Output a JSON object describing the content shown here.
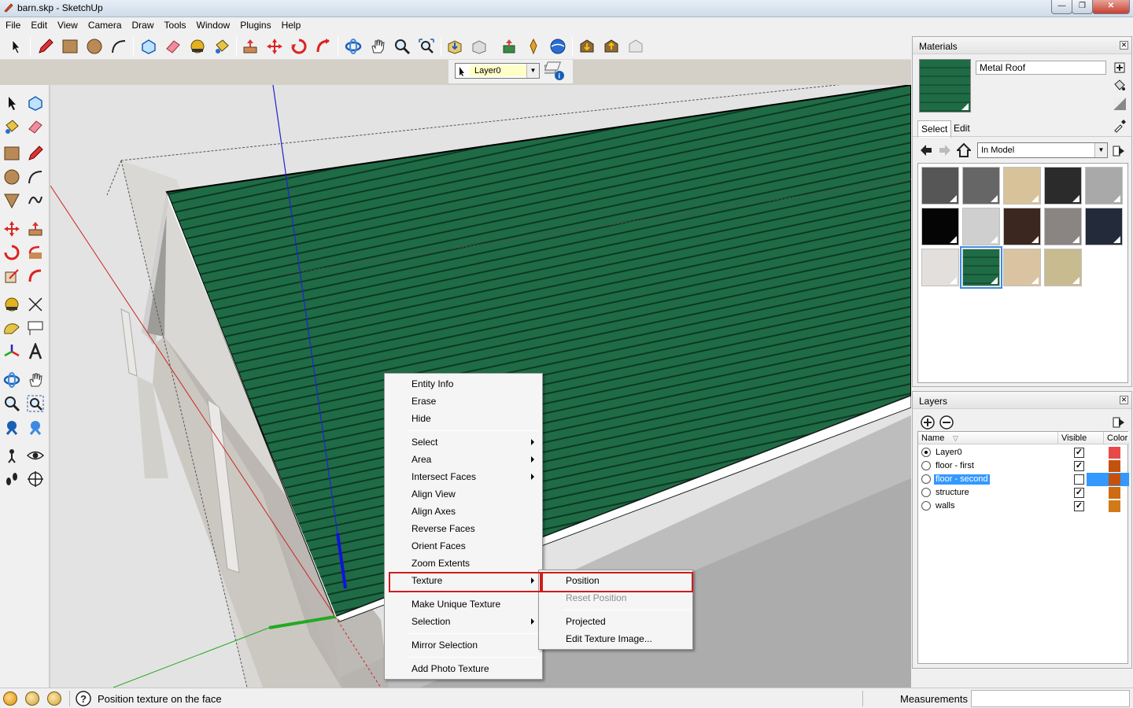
{
  "window": {
    "title": "barn.skp - SketchUp",
    "controls": {
      "minimize": "—",
      "maximize": "❐",
      "close": "✕"
    }
  },
  "menubar": [
    "File",
    "Edit",
    "View",
    "Camera",
    "Draw",
    "Tools",
    "Window",
    "Plugins",
    "Help"
  ],
  "layer_toolbar": {
    "current_layer": "Layer0"
  },
  "context_menu": {
    "items": [
      {
        "label": "Entity Info",
        "submenu": false
      },
      {
        "label": "Erase",
        "submenu": false
      },
      {
        "label": "Hide",
        "submenu": false
      },
      {
        "label": "Select",
        "submenu": true
      },
      {
        "label": "Area",
        "submenu": true
      },
      {
        "label": "Intersect Faces",
        "submenu": true
      },
      {
        "label": "Align View",
        "submenu": false
      },
      {
        "label": "Align Axes",
        "submenu": false
      },
      {
        "label": "Reverse Faces",
        "submenu": false
      },
      {
        "label": "Orient Faces",
        "submenu": false
      },
      {
        "label": "Zoom Extents",
        "submenu": false
      },
      {
        "label": "Texture",
        "submenu": true
      },
      {
        "label": "Make Unique Texture",
        "submenu": false
      },
      {
        "label": "Selection",
        "submenu": true
      },
      {
        "label": "Mirror Selection",
        "submenu": false
      },
      {
        "label": "Add Photo Texture",
        "submenu": false
      }
    ],
    "highlighted": "Texture"
  },
  "texture_submenu": {
    "items": [
      {
        "label": "Position",
        "disabled": false
      },
      {
        "label": "Reset Position",
        "disabled": true
      },
      {
        "label": "Projected",
        "disabled": false
      },
      {
        "label": "Edit Texture Image...",
        "disabled": false
      }
    ],
    "highlighted": "Position"
  },
  "materials_panel": {
    "title": "Materials",
    "current_material": "Metal Roof",
    "tabs": [
      "Select",
      "Edit"
    ],
    "active_tab": "Select",
    "collection": "In Model",
    "swatches": [
      {
        "color": "#565656"
      },
      {
        "color": "#666666"
      },
      {
        "color": "#d8c29a"
      },
      {
        "color": "#2b2b2b"
      },
      {
        "color": "#a9a9a9"
      },
      {
        "color": "#050505"
      },
      {
        "color": "#cfcfcf"
      },
      {
        "color": "#3b2620"
      },
      {
        "color": "#8a8482"
      },
      {
        "color": "#232b3a"
      },
      {
        "color": "#e3dfdd"
      },
      {
        "color": "#1f6b45",
        "selected": true
      },
      {
        "color": "#d9c3a0"
      },
      {
        "color": "#c9bb90"
      }
    ]
  },
  "layers_panel": {
    "title": "Layers",
    "columns": {
      "name": "Name",
      "visible": "Visible",
      "color": "Color"
    },
    "layers": [
      {
        "name": "Layer0",
        "active": true,
        "visible": true,
        "color": "#e84a4a",
        "selected": false
      },
      {
        "name": "floor - first",
        "active": false,
        "visible": true,
        "color": "#c4520e",
        "selected": false
      },
      {
        "name": "floor - second",
        "active": false,
        "visible": false,
        "color": "#c4520e",
        "selected": true
      },
      {
        "name": "structure",
        "active": false,
        "visible": true,
        "color": "#cf6a10",
        "selected": false
      },
      {
        "name": "walls",
        "active": false,
        "visible": true,
        "color": "#d07a1a",
        "selected": false
      }
    ]
  },
  "statusbar": {
    "hint": "Position texture on the face",
    "measurements_label": "Measurements",
    "measurements_value": ""
  },
  "colors": {
    "roof": "#1f6b45",
    "highlight_box": "#d11b1b",
    "selection_blue": "#3399ff",
    "axis_red": "#cc2222",
    "axis_green": "#22aa22",
    "axis_blue": "#2222cc"
  }
}
